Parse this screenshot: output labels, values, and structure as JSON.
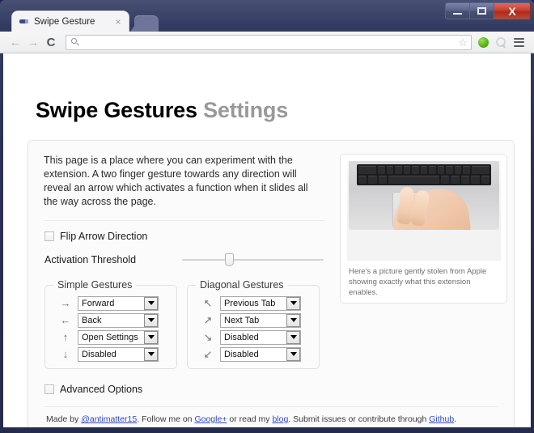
{
  "window": {
    "minimize_label": "Minimize",
    "maximize_label": "Maximize",
    "close_label": "X"
  },
  "browser": {
    "tab": {
      "title": "Swipe Gesture",
      "close_label": "×",
      "favicon_name": "swipe-gesture-favicon"
    },
    "newtab_label": "",
    "nav": {
      "back_label": "←",
      "forward_label": "→",
      "reload_label": "C"
    },
    "omnibox": {
      "value": "",
      "placeholder": "",
      "search_icon": "search-icon",
      "bookmark_star": "☆"
    },
    "toolbar_icons": [
      {
        "name": "extension-green-icon"
      },
      {
        "name": "extension-gray-icon"
      },
      {
        "name": "chrome-menu-icon"
      }
    ]
  },
  "page": {
    "title_main": "Swipe Gestures",
    "title_muted": "Settings",
    "intro": "This page is a place where you can experiment with the extension. A two finger gesture towards any direction will reveal an arrow which activates a function when it slides all the way across the page.",
    "flip_arrow": {
      "label": "Flip Arrow Direction",
      "checked": false
    },
    "activation_threshold": {
      "label": "Activation Threshold",
      "value_percent": 30
    },
    "simple_gestures": {
      "legend": "Simple Gestures",
      "rows": [
        {
          "arrow": "→",
          "arrow_name": "arrow-right",
          "value": "Forward"
        },
        {
          "arrow": "←",
          "arrow_name": "arrow-left",
          "value": "Back"
        },
        {
          "arrow": "↑",
          "arrow_name": "arrow-up",
          "value": "Open Settings"
        },
        {
          "arrow": "↓",
          "arrow_name": "arrow-down",
          "value": "Disabled"
        }
      ]
    },
    "diagonal_gestures": {
      "legend": "Diagonal Gestures",
      "rows": [
        {
          "arrow": "↖",
          "arrow_name": "arrow-up-left",
          "value": "Previous Tab"
        },
        {
          "arrow": "↗",
          "arrow_name": "arrow-up-right",
          "value": "Next Tab"
        },
        {
          "arrow": "↘",
          "arrow_name": "arrow-down-right",
          "value": "Disabled"
        },
        {
          "arrow": "↙",
          "arrow_name": "arrow-down-left",
          "value": "Disabled"
        }
      ]
    },
    "advanced_options": {
      "label": "Advanced Options",
      "checked": false
    },
    "image_card": {
      "caption": "Here's a picture gently stolen from Apple showing exactly what this extension enables.",
      "image_name": "macbook-trackpad-two-finger-swipe-photo"
    },
    "footer": {
      "part1": "Made by ",
      "link1": "@antimatter15",
      "part2": ". Follow me on ",
      "link2": "Google+",
      "part3": " or read my ",
      "link3": "blog",
      "part4": ". Submit issues or contribute through ",
      "link4": "Github",
      "part5": "."
    }
  },
  "colors": {
    "accent_blue": "#2f49c6",
    "swipe_blue": "#3fbbee",
    "title_muted": "#999999",
    "frame": "#2b3154"
  }
}
